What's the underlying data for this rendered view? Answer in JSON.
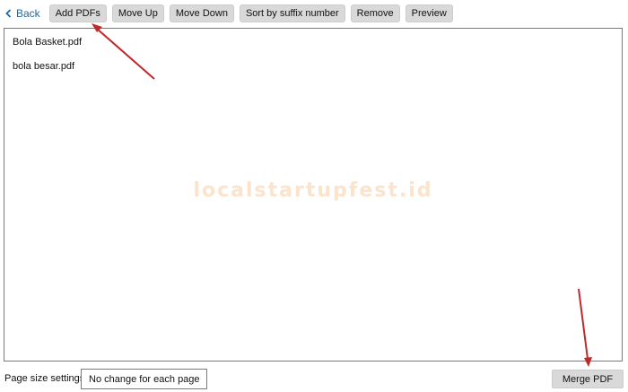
{
  "toolbar": {
    "back_label": "Back",
    "buttons": {
      "add_pdfs": "Add PDFs",
      "move_up": "Move Up",
      "move_down": "Move Down",
      "sort_suffix": "Sort by suffix number",
      "remove": "Remove",
      "preview": "Preview"
    }
  },
  "files": [
    "Bola Basket.pdf",
    "bola besar.pdf"
  ],
  "watermark": "localstartupfest.id",
  "page_size": {
    "label": "Page size settings:",
    "selected": "No change for each page"
  },
  "merge_label": "Merge PDF",
  "icons": {
    "back": "chevron-left-icon",
    "dropdown": "chevron-down-icon"
  },
  "colors": {
    "accent": "#1a6aa3",
    "button_bg": "#d9d9d9",
    "annotation_arrow": "#c0282c",
    "watermark": "#fbe3cc"
  }
}
